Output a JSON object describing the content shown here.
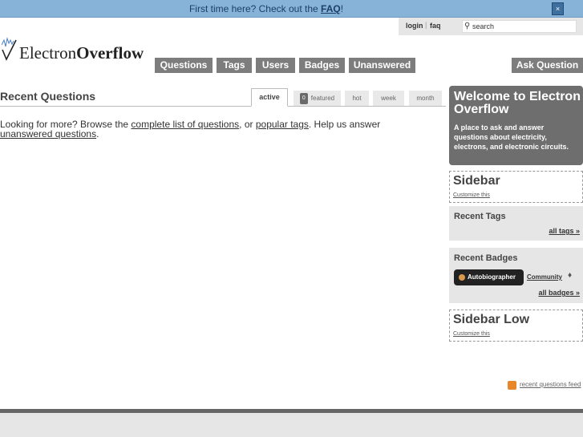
{
  "notify": {
    "text": "First time here? Check out the ",
    "link": "FAQ",
    "suffix": "!",
    "close": "×"
  },
  "userbar": {
    "login": "login",
    "faq": "faq",
    "separator": "|"
  },
  "search": {
    "placeholder": "search",
    "icon": "search-icon"
  },
  "logo": {
    "part1": "Electron",
    "part2": "Overflow"
  },
  "nav": {
    "questions": "Questions",
    "tags": "Tags",
    "users": "Users",
    "badges": "Badges",
    "unanswered": "Unanswered",
    "ask": "Ask Question"
  },
  "main": {
    "title": "Recent Questions",
    "tabs": {
      "active": "active",
      "featured_count": "0",
      "featured": "featured",
      "hot": "hot",
      "week": "week",
      "month": "month"
    },
    "more": {
      "t1": "Looking for more? Browse the ",
      "l1": "complete list of questions",
      "t2": ", or ",
      "l2": "popular tags",
      "t3": ". Help us answer ",
      "l3": "unanswered questions",
      "t4": "."
    }
  },
  "sidebar": {
    "welcome_title": "Welcome to Electron Overflow",
    "welcome_desc": "A place to ask and answer questions about electricity, electrons, and electronic circuits.",
    "sidebar_title": "Sidebar",
    "customize": "Customize this",
    "recent_tags_title": "Recent Tags",
    "all_tags": "all tags »",
    "recent_badges_title": "Recent Badges",
    "badge_name": "Autobiographer",
    "badge_user": "Community",
    "badge_user_mark": "♦",
    "all_badges": "all badges »",
    "sidebar_low_title": "Sidebar Low",
    "customize_low": "Customize this"
  },
  "feed": {
    "label": "recent questions feed",
    "icon": "rss-icon"
  },
  "colors": {
    "notify_bg": "#88b3d9",
    "nav_bg": "#7d7d7d",
    "welcome_bg": "#6e6e6e",
    "badge_bronze": "#d69a4d",
    "rss": "#e8862a"
  }
}
